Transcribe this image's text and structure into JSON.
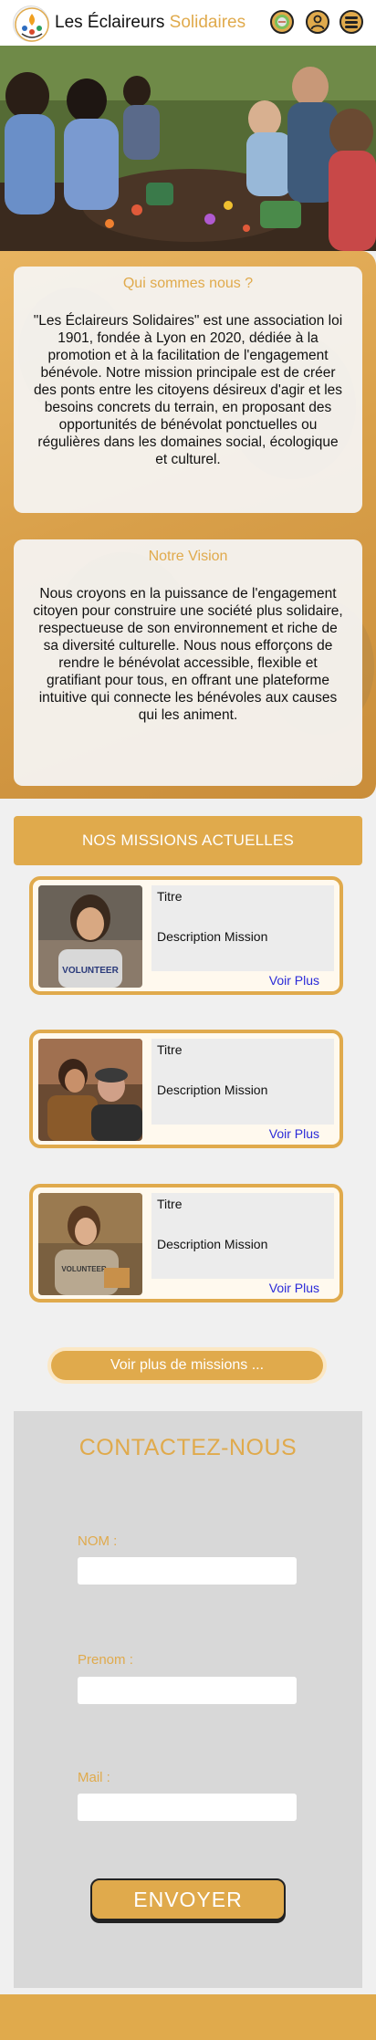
{
  "colors": {
    "accent": "#e0aa4c",
    "link": "#2a2ad8",
    "page_bg": "#f0f0f0"
  },
  "header": {
    "brand_part1": "Les Éclaireurs",
    "brand_part2": "Solidaires",
    "icons": [
      "logo-icon",
      "language-icon",
      "user-icon",
      "menu-icon"
    ]
  },
  "about": {
    "title": "Qui sommes nous ?",
    "text": "\"Les Éclaireurs Solidaires\" est une association loi 1901, fondée à Lyon en 2020, dédiée à la promotion et à la facilitation de l'engagement bénévole. Notre mission principale est de créer des ponts entre les citoyens désireux d'agir et les besoins concrets du terrain, en proposant des opportunités de bénévolat ponctuelles ou régulières dans les domaines social, écologique et culturel."
  },
  "vision": {
    "title": "Notre Vision",
    "text": "Nous croyons en la puissance de l'engagement citoyen pour construire une société plus solidaire, respectueuse de son environnement et riche de sa diversité culturelle. Nous nous efforçons de rendre le bénévolat accessible, flexible et gratifiant pour tous, en offrant une plateforme intuitive qui connecte les bénévoles aux causes qui les animent."
  },
  "missions": {
    "heading": "NOS MISSIONS ACTUELLES",
    "items": [
      {
        "title": "Titre",
        "description": "Description Mission",
        "link": "Voir Plus",
        "shirt_text": "VOLUNTEER"
      },
      {
        "title": "Titre",
        "description": "Description Mission",
        "link": "Voir Plus"
      },
      {
        "title": "Titre",
        "description": "Description Mission",
        "link": "Voir Plus",
        "shirt_text": "VOLUNTEER"
      }
    ],
    "more_button": "Voir plus de missions ..."
  },
  "contact": {
    "title": "CONTACTEZ-NOUS",
    "fields": [
      {
        "label": "NOM :",
        "value": ""
      },
      {
        "label": "Prenom :",
        "value": ""
      },
      {
        "label": "Mail :",
        "value": ""
      }
    ],
    "submit": "ENVOYER"
  }
}
